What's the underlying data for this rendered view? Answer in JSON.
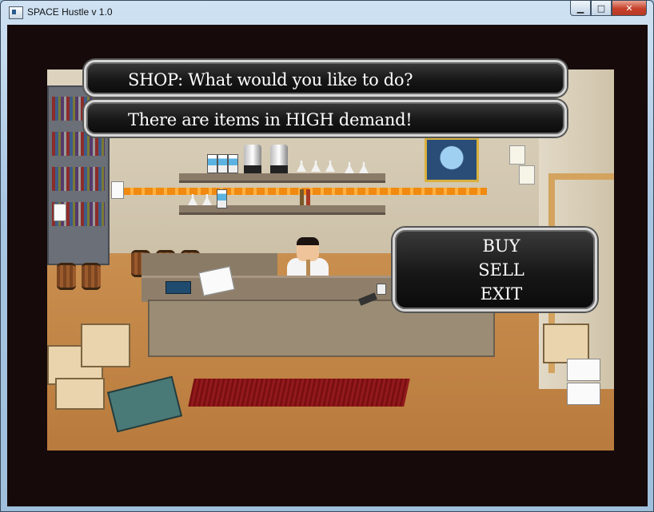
{
  "window": {
    "title": "SPACE Hustle v 1.0",
    "minimize_glyph": "▁",
    "maximize_glyph": "□",
    "close_glyph": "✕"
  },
  "dialog": {
    "line1": "SHOP: What would you like to do?",
    "line2": "There are items in HIGH demand!"
  },
  "menu": {
    "items": [
      {
        "label": "BUY"
      },
      {
        "label": "SELL"
      },
      {
        "label": "EXIT"
      }
    ]
  },
  "colors": {
    "frame_border": "#160a0a",
    "panel_background": "#171717",
    "panel_border": "#d7d7d7",
    "text": "#ffffff",
    "accent_stripe": "#f08a10"
  }
}
